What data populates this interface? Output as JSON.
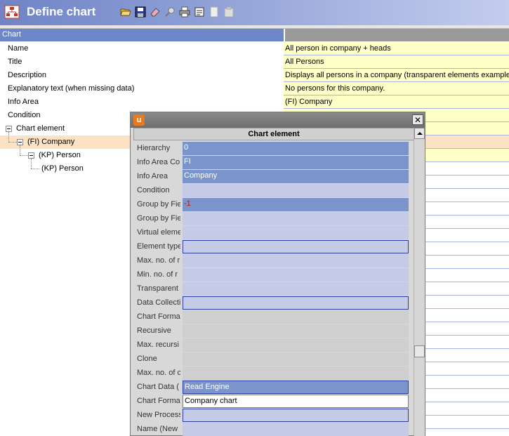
{
  "window": {
    "title": "Define chart"
  },
  "toolbar": {
    "buttons": [
      "open-icon",
      "save-icon",
      "eraser-icon",
      "search-icon",
      "print-icon",
      "export-icon",
      "copy-icon",
      "paste-icon"
    ]
  },
  "grid": {
    "header": "Chart",
    "rows": [
      {
        "label": "Name",
        "value": "All person in company + heads"
      },
      {
        "label": "Title",
        "value": "All Persons"
      },
      {
        "label": "Description",
        "value": "Displays all persons in a company (transparent elements example)"
      },
      {
        "label": "Explanatory text (when missing data)",
        "value": "No persons for this company."
      },
      {
        "label": "Info Area",
        "value": "(FI) Company"
      },
      {
        "label": "Condition",
        "value": ""
      }
    ],
    "tree": {
      "root": "Chart element",
      "level1": "(FI) Company",
      "level2": "(KP) Person",
      "level3": "(KP) Person"
    }
  },
  "dialog": {
    "header": "Chart element",
    "close_label": "✕",
    "fields": [
      {
        "label": "Hierarchy",
        "value": "0"
      },
      {
        "label": "Info Area Co",
        "value": "FI"
      },
      {
        "label": "Info Area",
        "value": "Company"
      },
      {
        "label": "Condition",
        "value": ""
      },
      {
        "label": "Group by Fie",
        "value": "-1"
      },
      {
        "label": "Group by Fie",
        "value": ""
      },
      {
        "label": "Virtual eleme",
        "value": ""
      },
      {
        "label": "Element type",
        "value": ""
      },
      {
        "label": "Max. no. of r",
        "value": ""
      },
      {
        "label": "Min. no. of r",
        "value": ""
      },
      {
        "label": "Transparent",
        "value": ""
      },
      {
        "label": "Data Collecti",
        "value": ""
      },
      {
        "label": "Chart Forma",
        "value": ""
      },
      {
        "label": "Recursive",
        "value": ""
      },
      {
        "label": "Max. recursi",
        "value": ""
      },
      {
        "label": "Clone",
        "value": ""
      },
      {
        "label": "Max. no. of c",
        "value": ""
      },
      {
        "label": "Chart Data (",
        "value": "Read Engine"
      },
      {
        "label": "Chart Forma",
        "value": "Company chart"
      },
      {
        "label": "New Process",
        "value": ""
      },
      {
        "label": "Name (New F",
        "value": ""
      }
    ]
  }
}
